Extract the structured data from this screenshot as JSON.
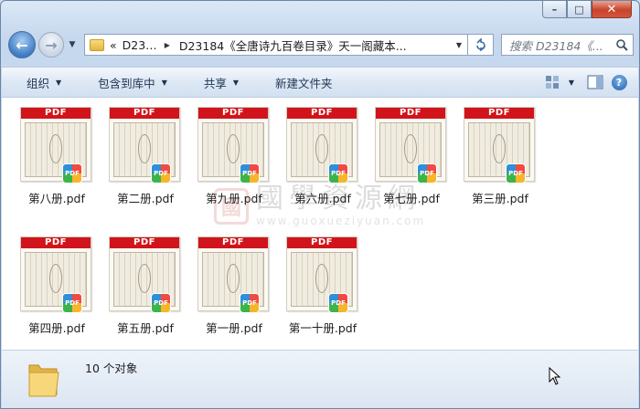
{
  "window": {
    "controls": {
      "minimize": "–",
      "maximize": "□",
      "close": "✕"
    }
  },
  "nav": {
    "back_glyph": "←",
    "forward_glyph": "→"
  },
  "address": {
    "overflow": "«",
    "root": "D23…",
    "path": "D23184《全唐诗九百卷目录》天一阁藏本..."
  },
  "search": {
    "placeholder": "搜索 D23184《..."
  },
  "toolbar": {
    "organize": "组织",
    "include_in_library": "包含到库中",
    "share": "共享",
    "new_folder": "新建文件夹",
    "help": "?"
  },
  "files": [
    {
      "name": "第八册.pdf",
      "band": "PDF"
    },
    {
      "name": "第二册.pdf",
      "band": "PDF"
    },
    {
      "name": "第九册.pdf",
      "band": "PDF"
    },
    {
      "name": "第六册.pdf",
      "band": "PDF"
    },
    {
      "name": "第七册.pdf",
      "band": "PDF"
    },
    {
      "name": "第三册.pdf",
      "band": "PDF"
    },
    {
      "name": "第四册.pdf",
      "band": "PDF"
    },
    {
      "name": "第五册.pdf",
      "band": "PDF"
    },
    {
      "name": "第一册.pdf",
      "band": "PDF"
    },
    {
      "name": "第一十册.pdf",
      "band": "PDF"
    }
  ],
  "watermark": {
    "seal": "國",
    "text": "國學資源網",
    "url": "www.guoxueziyuan.com"
  },
  "status": {
    "count": "10 个对象"
  },
  "colors": {
    "pdf_band": "#d1141b",
    "close_button": "#c9432b",
    "back_button": "#3d7bc4"
  }
}
